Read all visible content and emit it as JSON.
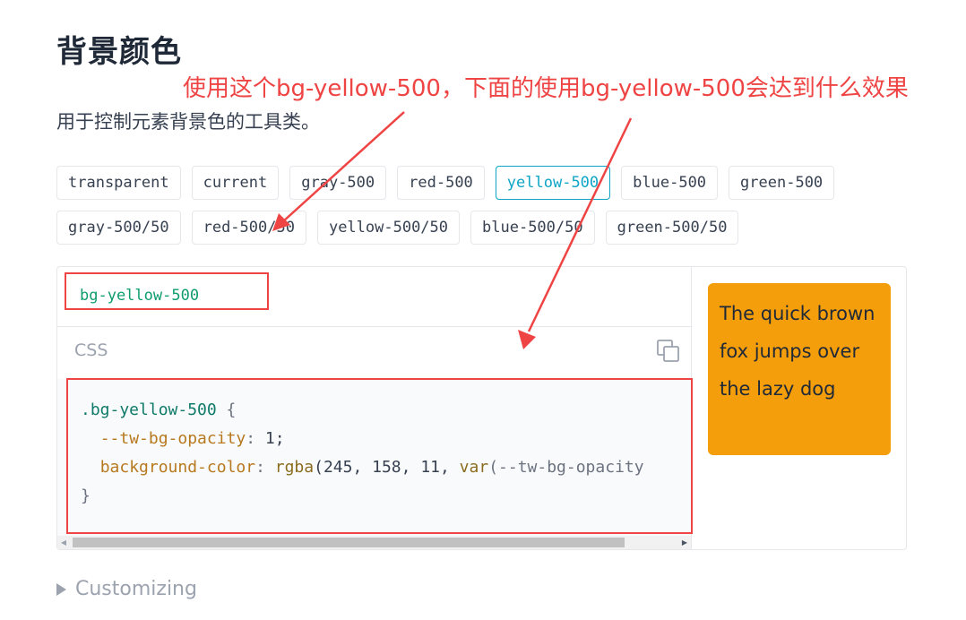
{
  "page": {
    "title": "背景颜色",
    "subtitle": "用于控制元素背景色的工具类。"
  },
  "annotation": {
    "text": "使用这个bg-yellow-500，下面的使用bg-yellow-500会达到什么效果",
    "color": "#ef4444"
  },
  "chips": {
    "row1": [
      "transparent",
      "current",
      "gray-500",
      "red-500",
      "yellow-500",
      "blue-500",
      "green-500"
    ],
    "row2": [
      "gray-500/50",
      "red-500/50",
      "yellow-500/50",
      "blue-500/50",
      "green-500/50"
    ],
    "active": "yellow-500"
  },
  "code": {
    "classname": "bg-yellow-500",
    "language": "CSS",
    "selector": ".bg-yellow-500",
    "open_brace": " {",
    "prop1": "--tw-bg-opacity",
    "val1": " 1;",
    "prop2": "background-color",
    "val2_fn": " rgba",
    "val2_args": "(245, 158, 11, ",
    "val2_var": "var",
    "val2_rest": "(--tw-bg-opacity",
    "close_brace": "}"
  },
  "preview": {
    "text": "The quick brown fox jumps over the lazy dog",
    "color": "#f59e0b"
  },
  "customizing": {
    "label": "Customizing"
  }
}
